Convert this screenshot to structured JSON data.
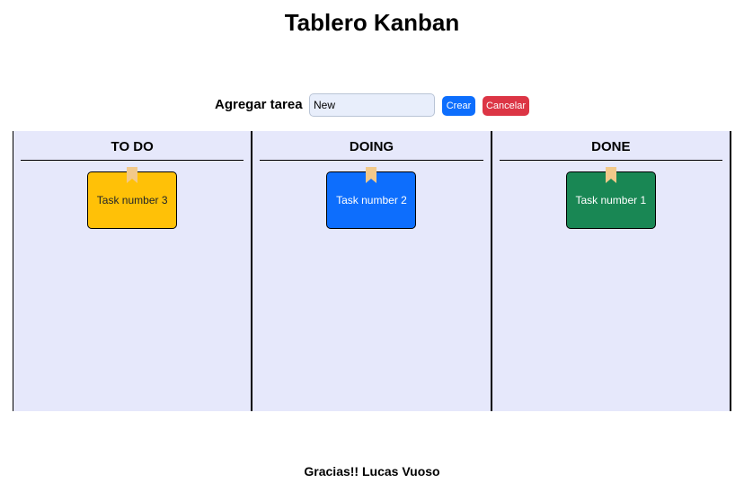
{
  "header": {
    "title": "Tablero Kanban"
  },
  "form": {
    "label": "Agregar tarea",
    "input_value": "New",
    "create_label": "Crear",
    "cancel_label": "Cancelar"
  },
  "board": {
    "columns": [
      {
        "title": "TO DO",
        "cards": [
          {
            "label": "Task number 3",
            "color": "#ffc107",
            "text_color": "#212529"
          }
        ]
      },
      {
        "title": "DOING",
        "cards": [
          {
            "label": "Task number 2",
            "color": "#0d6efd",
            "text_color": "#ffffff"
          }
        ]
      },
      {
        "title": "DONE",
        "cards": [
          {
            "label": "Task number 1",
            "color": "#198754",
            "text_color": "#ffffff"
          }
        ]
      }
    ]
  },
  "footer": {
    "text": "Gracias!! Lucas Vuoso"
  },
  "colors": {
    "column_bg": "#e6e8fb",
    "primary": "#0d6efd",
    "danger": "#dc3545",
    "bookmark": "#f2c98a"
  }
}
